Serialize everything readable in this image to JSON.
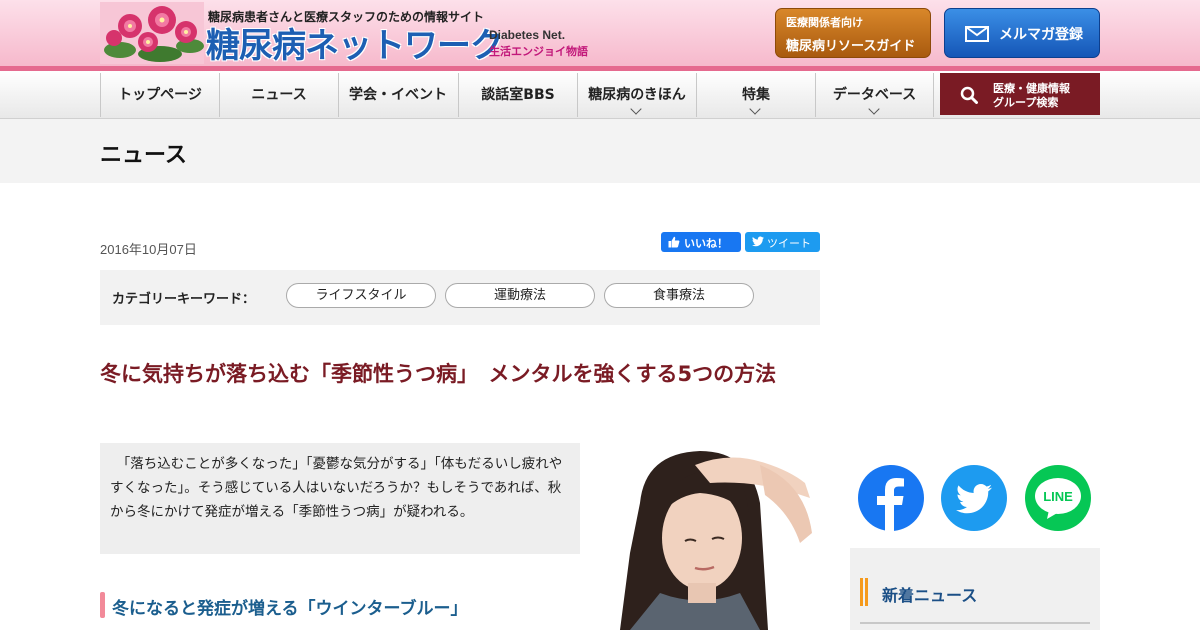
{
  "header": {
    "tagline": "糖尿病患者さんと医療スタッフのための情報サイト",
    "title": "糖尿病ネットワーク",
    "title_en": "Diabetes Net.",
    "subtitle": "生活エンジョイ物語",
    "resource_button": {
      "small": "医療関係者向け",
      "label": "糖尿病リソースガイド"
    },
    "mail_button": {
      "label": "メルマガ登録",
      "icon": "mail-icon"
    }
  },
  "nav": {
    "items": [
      {
        "label": "トップページ",
        "dropdown": false
      },
      {
        "label": "ニュース",
        "dropdown": false
      },
      {
        "label": "学会・イベント",
        "dropdown": false
      },
      {
        "label": "談話室BBS",
        "dropdown": false
      },
      {
        "label": "糖尿病のきほん",
        "dropdown": true
      },
      {
        "label": "特集",
        "dropdown": true
      },
      {
        "label": "データベース",
        "dropdown": true
      }
    ],
    "search": {
      "line1": "医療・健康情報",
      "line2": "グループ検索",
      "icon": "search-icon"
    }
  },
  "page": {
    "title": "ニュース"
  },
  "article": {
    "date": "2016年10月07日",
    "share": {
      "like": "いいね！",
      "tweet": "ツイート"
    },
    "category_label": "カテゴリーキーワード：",
    "categories": [
      "ライフスタイル",
      "運動療法",
      "食事療法"
    ],
    "headline": "冬に気持ちが落ち込む「季節性うつ病」　メンタルを強くする5つの方法",
    "lead": "　「落ち込むことが多くなった」「憂鬱な気分がする」「体もだるいし疲れやすくなった」。そう感じている人はいないだろうか？もしそうであれば、秋から冬にかけて発症が増える「季節性うつ病」が疑われる。",
    "section_title": "冬になると発症が増える「ウインターブルー」"
  },
  "sidebar": {
    "social": [
      {
        "name": "facebook",
        "icon": "facebook-icon"
      },
      {
        "name": "twitter",
        "icon": "twitter-icon"
      },
      {
        "name": "line",
        "icon": "line-icon",
        "label": "LINE"
      }
    ],
    "news_title": "新着ニュース"
  },
  "colors": {
    "header_pink": "#f6b9cc",
    "accent_maroon": "#7a1b24",
    "title_blue": "#1d5fb3",
    "section_blue": "#1b5e8e"
  }
}
